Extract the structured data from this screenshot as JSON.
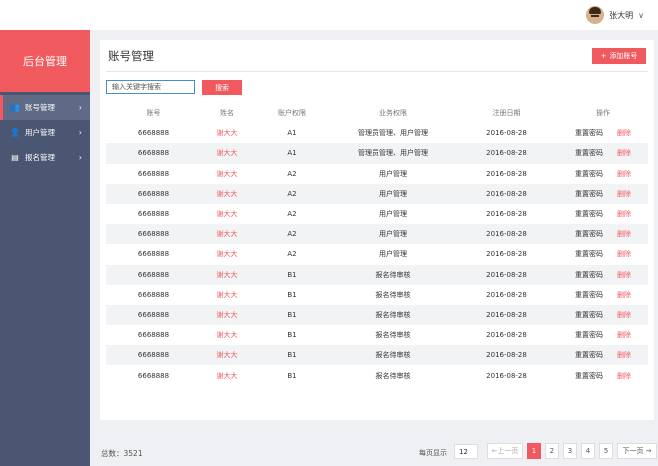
{
  "user": {
    "name": "张大明",
    "chevron": "∨"
  },
  "sidebar": {
    "brand": "后台管理",
    "items": [
      {
        "label": "账号管理",
        "icon": "user-group-icon",
        "glyph": "👥",
        "arrow": "›"
      },
      {
        "label": "用户管理",
        "icon": "user-icon",
        "glyph": "👤",
        "arrow": "›"
      },
      {
        "label": "报名管理",
        "icon": "clipboard-icon",
        "glyph": "▤",
        "arrow": "›"
      }
    ]
  },
  "main": {
    "title": "账号管理",
    "add_button": {
      "plus": "+",
      "label": "添加账号"
    },
    "search": {
      "placeholder": "输入关键字搜索",
      "button": "搜索"
    },
    "table": {
      "headers": [
        "账号",
        "姓名",
        "账户权限",
        "业务权限",
        "注册日期",
        "操作"
      ],
      "op_reset": "重置密码",
      "op_delete": "删除",
      "rows": [
        [
          "6668888",
          "谢大大",
          "A1",
          "管理员管理、用户管理",
          "2016-08-28"
        ],
        [
          "6668888",
          "谢大大",
          "A1",
          "管理员管理、用户管理",
          "2016-08-28"
        ],
        [
          "6668888",
          "谢大大",
          "A2",
          "用户管理",
          "2016-08-28"
        ],
        [
          "6668888",
          "谢大大",
          "A2",
          "用户管理",
          "2016-08-28"
        ],
        [
          "6668888",
          "谢大大",
          "A2",
          "用户管理",
          "2016-08-28"
        ],
        [
          "6668888",
          "谢大大",
          "A2",
          "用户管理",
          "2016-08-28"
        ],
        [
          "6668888",
          "谢大大",
          "A2",
          "用户管理",
          "2016-08-28"
        ],
        [
          "6668888",
          "谢大大",
          "B1",
          "报名待审核",
          "2016-08-28"
        ],
        [
          "6668888",
          "谢大大",
          "B1",
          "报名待审核",
          "2016-08-28"
        ],
        [
          "6668888",
          "谢大大",
          "B1",
          "报名待审核",
          "2016-08-28"
        ],
        [
          "6668888",
          "谢大大",
          "B1",
          "报名待审核",
          "2016-08-28"
        ],
        [
          "6668888",
          "谢大大",
          "B1",
          "报名待审核",
          "2016-08-28"
        ],
        [
          "6668888",
          "谢大大",
          "B1",
          "报名待审核",
          "2016-08-28"
        ]
      ]
    }
  },
  "footer": {
    "total": "总数：3521",
    "per_page_label": "每页显示",
    "per_page_value": "12",
    "prev": "←上一页",
    "pages": [
      "1",
      "2",
      "3",
      "4",
      "5"
    ],
    "next": "下一页 →"
  },
  "colors": {
    "accent": "#f05a5e",
    "sidebar": "#4a5672"
  }
}
